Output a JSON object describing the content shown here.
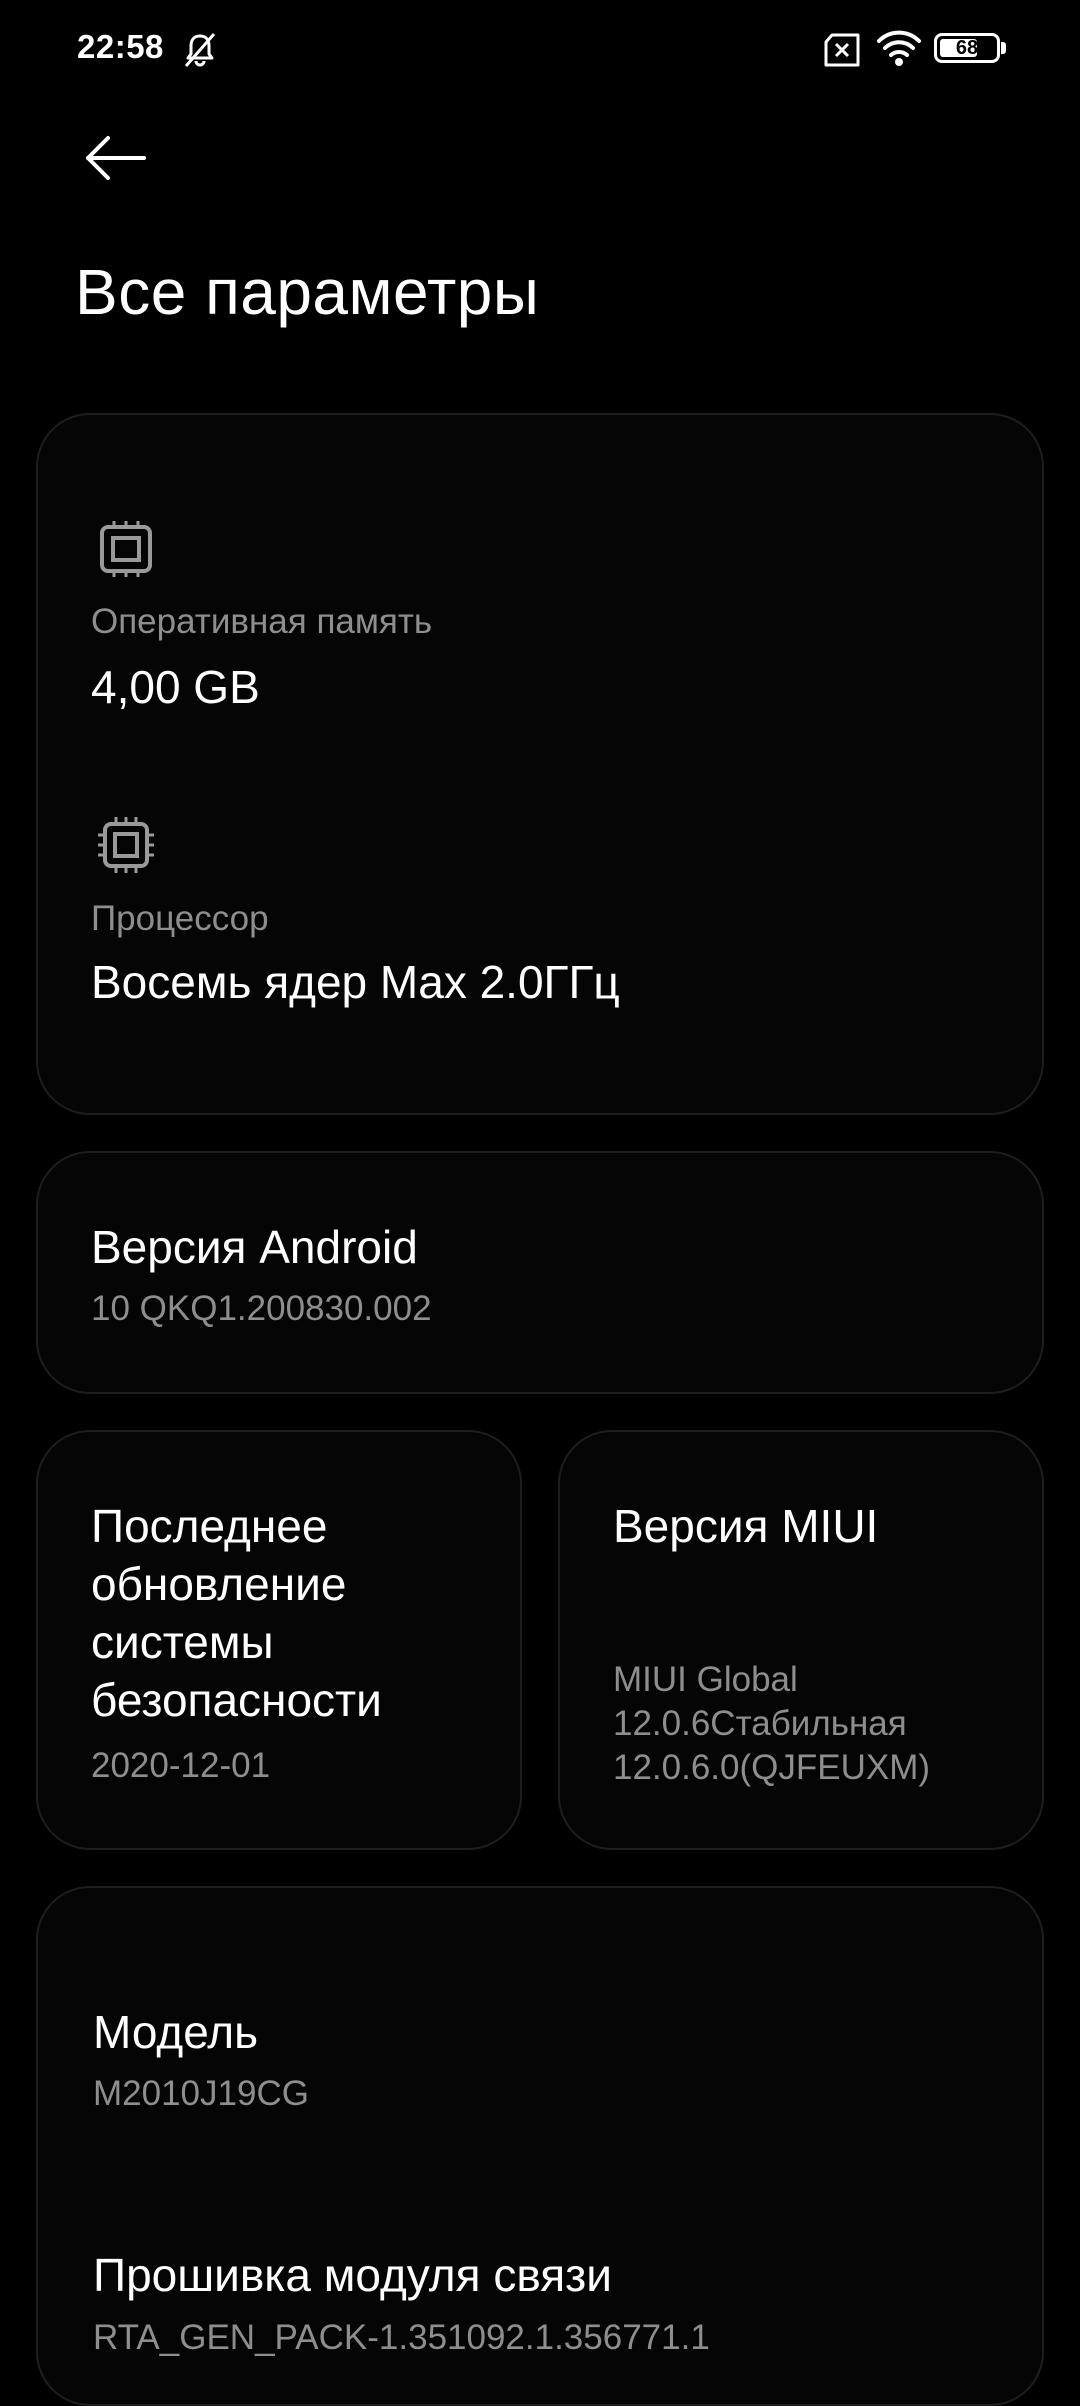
{
  "status_bar": {
    "time": "22:58",
    "battery_level": "68",
    "icons": [
      "dnd-icon",
      "sim-error-icon",
      "wifi-icon",
      "battery-icon"
    ]
  },
  "header": {
    "back_icon": "back-arrow-icon",
    "title": "Все параметры"
  },
  "hardware": {
    "ram": {
      "icon": "chip-icon",
      "label": "Оперативная память",
      "value": "4,00 GB"
    },
    "cpu": {
      "icon": "cpu-icon",
      "label": "Процессор",
      "value": "Восемь ядер Max 2.0ГГц"
    }
  },
  "android": {
    "title": "Версия Android",
    "value": "10 QKQ1.200830.002"
  },
  "security": {
    "title_lines": [
      "Последнее",
      "обновление",
      "системы",
      "безопасности"
    ],
    "value": "2020-12-01"
  },
  "miui": {
    "title": "Версия MIUI",
    "value_lines": [
      "MIUI Global",
      "12.0.6Стабильная",
      "12.0.6.0(QJFEUXM)"
    ]
  },
  "model": {
    "title": "Модель",
    "value": "M2010J19CG"
  },
  "baseband": {
    "title": "Прошивка модуля связи",
    "value": "RTA_GEN_PACK-1.351092.1.356771.1"
  },
  "colors": {
    "background": "#000000",
    "card_border": "#1e1e1e",
    "text_primary": "#ffffff",
    "text_secondary": "#8e8e8e"
  }
}
